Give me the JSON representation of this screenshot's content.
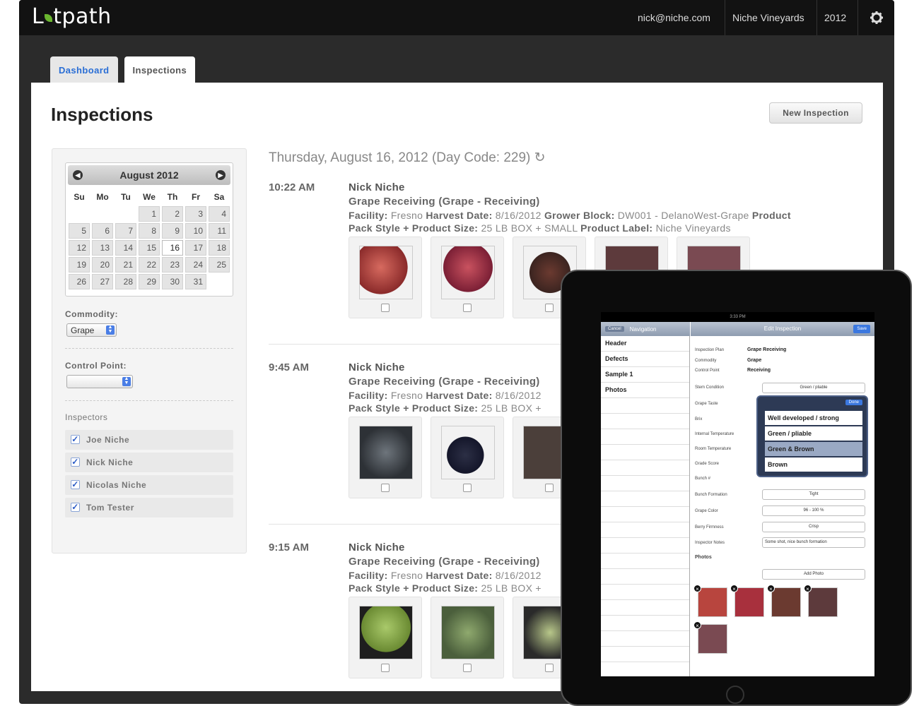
{
  "app": {
    "logo": "Lotpath"
  },
  "header": {
    "user_email": "nick@niche.com",
    "org": "Niche Vineyards",
    "year": "2012",
    "settings_icon": "gear-icon"
  },
  "tabs": [
    {
      "label": "Dashboard",
      "active": false
    },
    {
      "label": "Inspections",
      "active": true
    }
  ],
  "page": {
    "title": "Inspections",
    "new_button": "New Inspection"
  },
  "calendar": {
    "month_label": "August 2012",
    "prev_icon": "chevron-left-icon",
    "next_icon": "chevron-right-icon",
    "weekdays": [
      "Su",
      "Mo",
      "Tu",
      "We",
      "Th",
      "Fr",
      "Sa"
    ],
    "leading_blanks": 3,
    "days": 31,
    "selected_day": 16
  },
  "filters": {
    "commodity_label": "Commodity:",
    "commodity_value": "Grape",
    "control_point_label": "Control Point:",
    "control_point_value": "",
    "inspectors_label": "Inspectors",
    "inspectors": [
      {
        "name": "Joe Niche",
        "checked": true
      },
      {
        "name": "Nick Niche",
        "checked": true
      },
      {
        "name": "Nicolas Niche",
        "checked": true
      },
      {
        "name": "Tom Tester",
        "checked": true
      }
    ]
  },
  "day_header": "Thursday, August 16, 2012 (Day Code: 229) ↻",
  "inspections": [
    {
      "time": "10:22 AM",
      "inspector": "Nick Niche",
      "plan": "Grape Receiving (Grape - Receiving)",
      "facility_label": "Facility:",
      "facility": "Fresno",
      "harvest_label": "Harvest Date:",
      "harvest": "8/16/2012",
      "grower_label": "Grower Block:",
      "grower": "DW001 - DelanoWest-Grape",
      "product_label": "Product",
      "pack_label": "Pack Style + Product Size:",
      "pack": "25 LB BOX + SMALL",
      "label_label": "Product Label:",
      "label": "Niche Vineyards",
      "photo_colors": [
        "#b8453e",
        "#a8303d",
        "#6b3a30",
        "#5d3a3c",
        "#7a4a52"
      ]
    },
    {
      "time": "9:45 AM",
      "inspector": "Nick Niche",
      "plan": "Grape Receiving (Grape - Receiving)",
      "facility_label": "Facility:",
      "facility": "Fresno",
      "harvest_label": "Harvest Date:",
      "harvest": "8/16/2012",
      "pack_label": "Pack Style + Product Size:",
      "pack": "25 LB BOX +",
      "photo_colors": [
        "#4a4f54",
        "#2c2f45",
        "#4b3f3a"
      ]
    },
    {
      "time": "9:15 AM",
      "inspector": "Nick Niche",
      "plan": "Grape Receiving (Grape - Receiving)",
      "facility_label": "Facility:",
      "facility": "Fresno",
      "harvest_label": "Harvest Date:",
      "harvest": "8/16/2012",
      "pack_label": "Pack Style + Product Size:",
      "pack": "25 LB BOX +",
      "photo_colors": [
        "#8fb356",
        "#6d8a52",
        "#a5b87a"
      ]
    }
  ],
  "ipad": {
    "status_time": "3:33 PM",
    "nav_title": "Navigation",
    "cancel": "Cancel",
    "edit_title": "Edit Inspection",
    "save": "Save",
    "sections": [
      "Header",
      "Defects",
      "Sample 1",
      "Photos"
    ],
    "plan_label": "Inspection Plan",
    "plan_value": "Grape Receiving",
    "commodity_label": "Commodity",
    "commodity_value": "Grape",
    "cp_label": "Control Point",
    "cp_value": "Receiving",
    "fields": [
      {
        "label": "Stem Condition",
        "value": "Green / pliable"
      },
      {
        "label": "Grape Taste",
        "value": ""
      },
      {
        "label": "Brix",
        "value": ""
      },
      {
        "label": "Internal Temperature",
        "value": ""
      },
      {
        "label": "Room Temperature",
        "value": ""
      },
      {
        "label": "Grade Score",
        "value": ""
      },
      {
        "label": "Bunch #",
        "value": ""
      },
      {
        "label": "Bunch Formation",
        "value": "Tight"
      },
      {
        "label": "Grape Color",
        "value": "96 - 100 %"
      },
      {
        "label": "Berry Firmness",
        "value": "Crisp"
      },
      {
        "label": "Inspector Notes",
        "value": "Some shot, nice bunch formation"
      }
    ],
    "photos_label": "Photos",
    "add_photo": "Add Photo",
    "popover_done": "Done",
    "popover_options": [
      "Well developed / strong",
      "Green / pliable",
      "Green & Brown",
      "Brown"
    ]
  }
}
